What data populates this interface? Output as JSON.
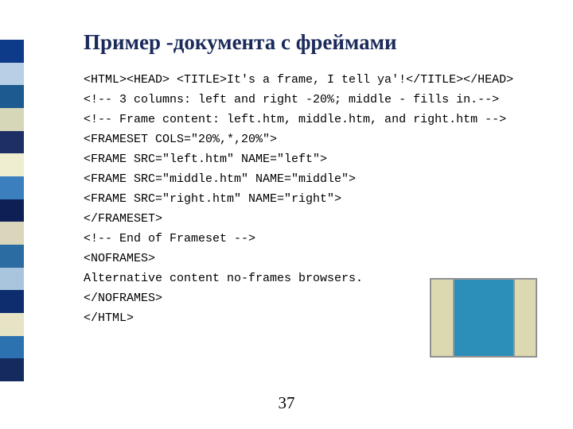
{
  "title": "Пример -документа с фреймами",
  "code": {
    "l1": "<HTML><HEAD> <TITLE>It's a frame, I tell ya'!</TITLE></HEAD>",
    "l2": "<!-- 3 columns: left and right -20%; middle - fills in.-->",
    "l3": "<!-- Frame content: left.htm, middle.htm, and right.htm -->",
    "l4": "<FRAMESET COLS=\"20%,*,20%\">",
    "l5": "<FRAME SRC=\"left.htm\" NAME=\"left\">",
    "l6": "<FRAME SRC=\"middle.htm\" NAME=\"middle\">",
    "l7": "<FRAME SRC=\"right.htm\" NAME=\"right\">",
    "l8": "</FRAMESET>",
    "l9": "<!-- End of Frameset -->",
    "l10": "<NOFRAMES>",
    "l11": "Alternative content no-frames browsers.",
    "l12": "</NOFRAMES>",
    "l13": "</HTML>"
  },
  "sidebar_colors": [
    "#0e3a8a",
    "#b8cfe5",
    "#1c5a8f",
    "#d6d6b8",
    "#1e2f66",
    "#f0eed0",
    "#3b7fbf",
    "#0e1f55",
    "#d9d6bb",
    "#2b6ca3",
    "#a8c5dd",
    "#0d2d6f",
    "#e6e4c4",
    "#2d72b0",
    "#152a5f"
  ],
  "page_number": "37"
}
